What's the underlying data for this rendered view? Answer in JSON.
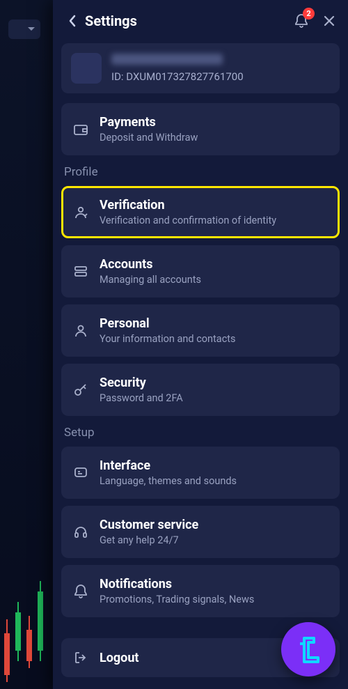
{
  "header": {
    "title": "Settings",
    "badge_count": "2"
  },
  "account": {
    "id_prefix": "ID: ",
    "id_value": "DXUM017327827761700"
  },
  "payments": {
    "label": "Payments",
    "sub": "Deposit and Withdraw"
  },
  "sections": {
    "profile_label": "Profile",
    "setup_label": "Setup"
  },
  "profile": {
    "verification": {
      "label": "Verification",
      "sub": "Verification and confirmation of identity"
    },
    "accounts": {
      "label": "Accounts",
      "sub": "Managing all accounts"
    },
    "personal": {
      "label": "Personal",
      "sub": "Your information and contacts"
    },
    "security": {
      "label": "Security",
      "sub": "Password and 2FA"
    }
  },
  "setup": {
    "interface": {
      "label": "Interface",
      "sub": "Language, themes and sounds"
    },
    "support": {
      "label": "Customer service",
      "sub": "Get any help 24/7"
    },
    "notifications": {
      "label": "Notifications",
      "sub": "Promotions, Trading signals, News"
    }
  },
  "logout": {
    "label": "Logout"
  }
}
